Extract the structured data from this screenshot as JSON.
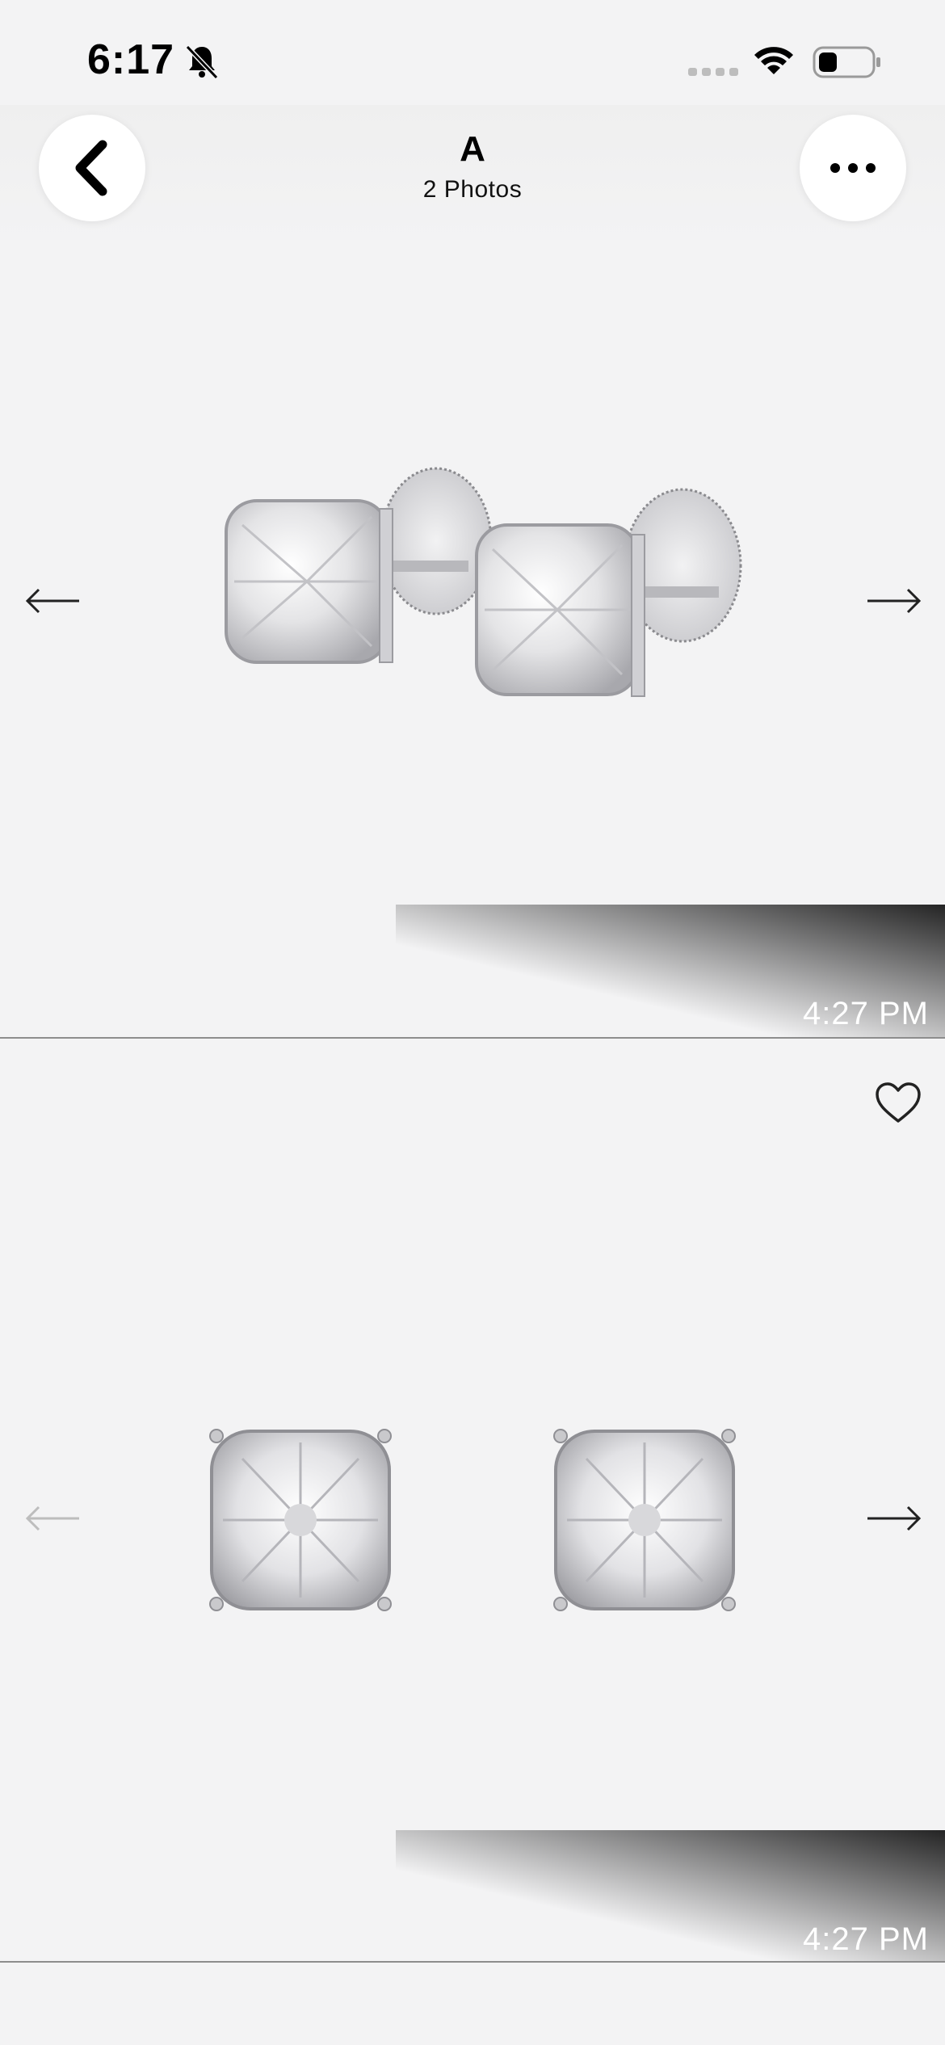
{
  "status_bar": {
    "time": "6:17",
    "icons": [
      "bell-slash-icon",
      "signal-icon",
      "wifi-icon",
      "battery-icon"
    ]
  },
  "header": {
    "title": "A",
    "subtitle": "2 Photos",
    "back_icon": "chevron-left-icon",
    "more_icon": "ellipsis-icon"
  },
  "photos": [
    {
      "timestamp": "4:27 PM",
      "prev_enabled": true,
      "next_enabled": true
    },
    {
      "timestamp": "4:27 PM",
      "prev_enabled": false,
      "next_enabled": true,
      "favorite_icon": "heart-icon"
    }
  ],
  "colors": {
    "background": "#f3f3f4",
    "arrow_active": "#222222",
    "arrow_disabled": "#bdbdbd",
    "timestamp_text": "#ffffff"
  }
}
